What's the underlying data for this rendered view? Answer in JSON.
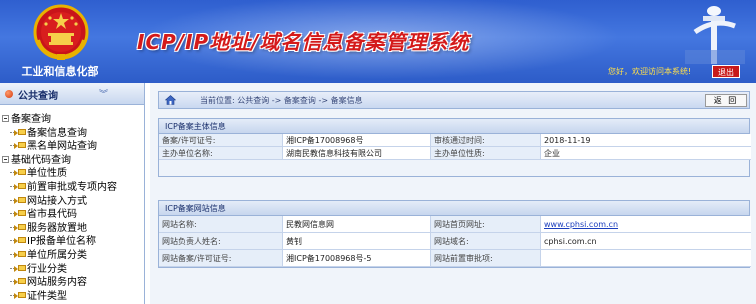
{
  "header": {
    "ministry": "工业和信息化部",
    "title": "ICP/IP地址/域名信息备案管理系统",
    "welcome": "您好，欢迎访问本系统!",
    "logout": "退出"
  },
  "sidebar": {
    "title": "公共查询",
    "items": [
      {
        "label": "备案查询",
        "level": 0
      },
      {
        "label": "备案信息查询",
        "level": 1
      },
      {
        "label": "黑名单网站查询",
        "level": 1
      },
      {
        "label": "基础代码查询",
        "level": 0
      },
      {
        "label": "单位性质",
        "level": 1
      },
      {
        "label": "前置审批或专项内容",
        "level": 1
      },
      {
        "label": "网站接入方式",
        "level": 1
      },
      {
        "label": "省市县代码",
        "level": 1
      },
      {
        "label": "服务器放置地",
        "level": 1
      },
      {
        "label": "IP报备单位名称",
        "level": 1
      },
      {
        "label": "单位所属分类",
        "level": 1
      },
      {
        "label": "行业分类",
        "level": 1
      },
      {
        "label": "网站服务内容",
        "level": 1
      },
      {
        "label": "证件类型",
        "level": 1
      }
    ]
  },
  "breadcrumb": {
    "text": "当前位置:  公共查询  -> 备案查询  -> 备案信息",
    "back": "返 回"
  },
  "subject_panel": {
    "title": "ICP备案主体信息",
    "rows": [
      [
        "备案/许可证号:",
        "湘ICP备17008968号",
        "审核通过时间:",
        "2018-11-19"
      ],
      [
        "主办单位名称:",
        "湖南民教信息科技有限公司",
        "主办单位性质:",
        "企业"
      ]
    ]
  },
  "site_panel": {
    "title": "ICP备案网站信息",
    "rows": [
      [
        "网站名称:",
        "民教网信息网",
        "网站首页网址:",
        "www.cphsi.com.cn"
      ],
      [
        "网站负责人姓名:",
        "黄钊",
        "网站域名:",
        "cphsi.com.cn"
      ],
      [
        "网站备案/许可证号:",
        "湘ICP备17008968号-5",
        "网站前置审批项:",
        ""
      ]
    ]
  }
}
